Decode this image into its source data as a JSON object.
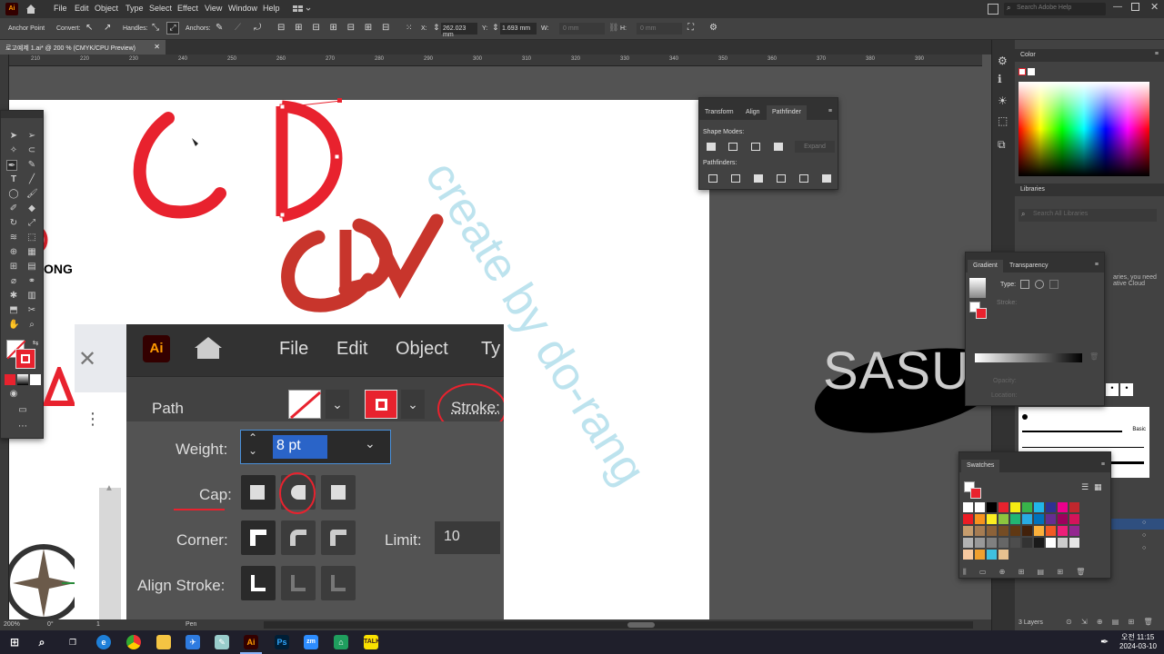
{
  "menubar": {
    "logo": "Ai",
    "items": [
      "File",
      "Edit",
      "Object",
      "Type",
      "Select",
      "Effect",
      "View",
      "Window",
      "Help"
    ],
    "search_placeholder": "Search Adobe Help"
  },
  "controlbar": {
    "anchor_point": "Anchor Point",
    "convert": "Convert:",
    "handles": "Handles:",
    "anchors": "Anchors:",
    "x_label": "X:",
    "x_value": "262.023 mm",
    "y_label": "Y:",
    "y_value": "1.693 mm",
    "w_label": "W:",
    "w_value": "0 mm",
    "h_label": "H:",
    "h_value": "0 mm"
  },
  "document": {
    "tab_title": "로고예제 1.ai* @ 200 % (CMYK/CPU Preview)",
    "ruler_ticks": [
      "210",
      "220",
      "230",
      "240",
      "250",
      "260",
      "270",
      "280",
      "290",
      "300",
      "310",
      "320",
      "330",
      "340",
      "350",
      "360",
      "370",
      "380",
      "390"
    ]
  },
  "canvas": {
    "watermark": "create by do-rang",
    "partial_text": "ONG",
    "sasu_text": "SASU",
    "colors": {
      "red": "#e8222e",
      "dark_red": "#c8352c",
      "watermark": "#bde3ee"
    }
  },
  "statusbar": {
    "zoom": "200%",
    "angle": "0°",
    "page": "1",
    "tool": "Pen"
  },
  "pathfinder_panel": {
    "tabs": [
      "Transform",
      "Align",
      "Pathfinder"
    ],
    "shape_modes": "Shape Modes:",
    "expand": "Expand",
    "pathfinders": "Pathfinders:"
  },
  "color_panel": {
    "title": "Color"
  },
  "libraries_panel": {
    "title": "Libraries",
    "search_placeholder": "Search All Libraries",
    "partial_text": "aries, you need\native Cloud"
  },
  "gradient_panel": {
    "tabs": [
      "Gradient",
      "Transparency"
    ],
    "type": "Type:",
    "stroke": "Stroke:",
    "opacity": "Opacity:",
    "location": "Location:"
  },
  "brushes_panel": {
    "basic": "Basic"
  },
  "swatches_panel": {
    "title": "Swatches"
  },
  "layers": {
    "count": "3 Layers"
  },
  "zoom_overlay": {
    "menu": [
      "File",
      "Edit",
      "Object",
      "Ty"
    ],
    "path_label": "Path",
    "stroke_label": "Stroke:",
    "weight_label": "Weight:",
    "weight_value": "8 pt",
    "cap_label": "Cap:",
    "corner_label": "Corner:",
    "limit_label": "Limit:",
    "limit_value": "10",
    "align_label": "Align Stroke:"
  },
  "taskbar": {
    "time": "오전 11:15",
    "date": "2024-03-10"
  }
}
